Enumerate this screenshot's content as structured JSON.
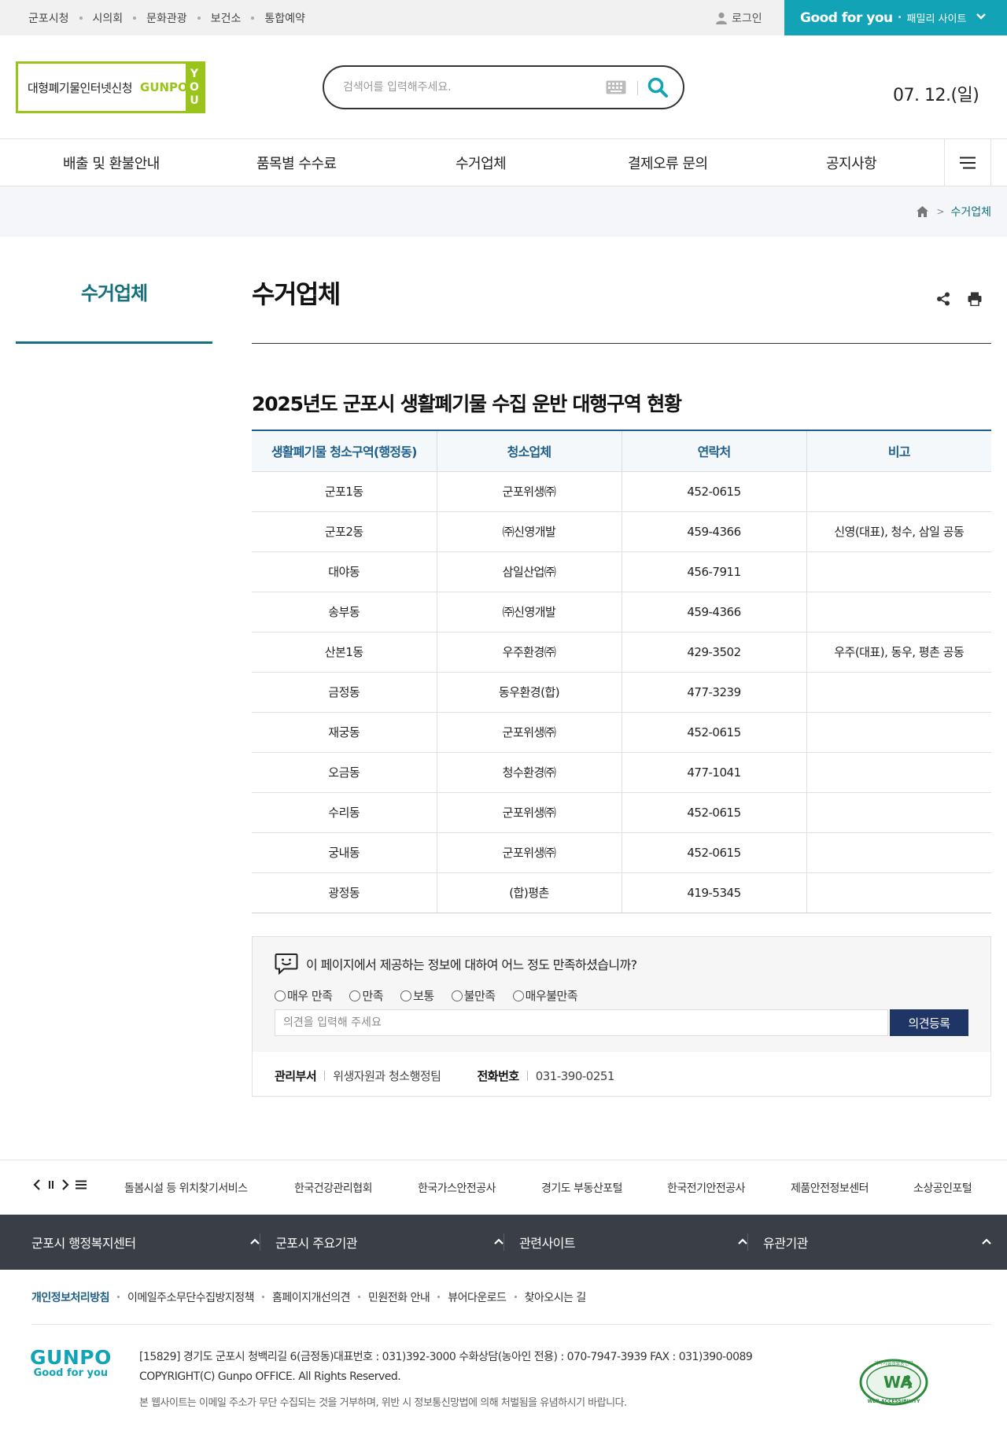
{
  "topbar": {
    "sites": [
      "군포시청",
      "시의회",
      "문화관광",
      "보건소",
      "통합예약"
    ],
    "login": "로그인",
    "family_brand": "Good for you",
    "family_label": "패밀리 사이트"
  },
  "header": {
    "logo_text": "대형폐기물인터넷신청",
    "logo_gunpo": "GUNPO",
    "logo_you": [
      "Y",
      "O",
      "U"
    ],
    "search_placeholder": "검색어를 입력해주세요.",
    "date": "07. 12.(일)"
  },
  "gnb": {
    "items": [
      "배출 및 환불안내",
      "품목별 수수료",
      "수거업체",
      "결제오류 문의",
      "공지사항"
    ]
  },
  "breadcrumb": {
    "current": "수거업체"
  },
  "lnb": {
    "title": "수거업체"
  },
  "page": {
    "title": "수거업체",
    "section_title": "2025년도 군포시 생활폐기물 수집 운반 대행구역 현황"
  },
  "table": {
    "headers": [
      "생활폐기물 청소구역(행정동)",
      "청소업체",
      "연락처",
      "비고"
    ],
    "rows": [
      [
        "군포1동",
        "군포위생㈜",
        "452-0615",
        ""
      ],
      [
        "군포2동",
        "㈜신영개발",
        "459-4366",
        "신영(대표), 청수, 삼일 공동"
      ],
      [
        "대야동",
        "삼일산업㈜",
        "456-7911",
        ""
      ],
      [
        "송부동",
        "㈜신영개발",
        "459-4366",
        ""
      ],
      [
        "산본1동",
        "우주환경㈜",
        "429-3502",
        "우주(대표), 동우, 평촌 공동"
      ],
      [
        "금정동",
        "동우환경(합)",
        "477-3239",
        ""
      ],
      [
        "재궁동",
        "군포위생㈜",
        "452-0615",
        ""
      ],
      [
        "오금동",
        "청수환경㈜",
        "477-1041",
        ""
      ],
      [
        "수리동",
        "군포위생㈜",
        "452-0615",
        ""
      ],
      [
        "궁내동",
        "군포위생㈜",
        "452-0615",
        ""
      ],
      [
        "광정동",
        "(합)평촌",
        "419-5345",
        ""
      ]
    ]
  },
  "survey": {
    "question": "이 페이지에서 제공하는 정보에 대하여 어느 정도 만족하셨습니까?",
    "options": [
      "매우 만족",
      "만족",
      "보통",
      "불만족",
      "매우불만족"
    ],
    "opinion_placeholder": "의견을 입력해 주세요",
    "submit": "의견등록",
    "manager_label": "관리부서",
    "manager_value": "위생자원과 청소행정팀",
    "phone_label": "전화번호",
    "phone_value": "031-390-0251"
  },
  "banner": {
    "sites": [
      "돌봄시설 등 위치찾기서비스",
      "한국건강관리협회",
      "한국가스안전공사",
      "경기도 부동산포털",
      "한국전기안전공사",
      "제품안전정보센터",
      "소상공인포털"
    ]
  },
  "footer_bar": [
    "군포시 행정복지센터",
    "군포시 주요기관",
    "관련사이트",
    "유관기관"
  ],
  "footer_links": [
    "개인정보처리방침",
    "이메일주소무단수집방지정책",
    "홈페이지개선의견",
    "민원전화 안내",
    "뷰어다운로드",
    "찾아오시는 길"
  ],
  "footer": {
    "logo": "GUNPO",
    "logo_sub": "Good for you",
    "address": "[15829] 경기도 군포시 청백리길 6(금정동)대표번호 : 031)392-3000 수화상담(농아인 전용) : 070-7947-3939 FAX : 031)390-0089",
    "copyright": "COPYRIGHT(C) Gunpo OFFICE. All Rights Reserved.",
    "warning": "본 웹사이트는 이메일 주소가 무단 수집되는 것을 거부하며, 위반 시 정보통신망법에 의해 처벌됨을 유념하시기 바랍니다.",
    "wa_label": "WA",
    "wa_top": "과학기술정보통신부",
    "wa_bottom": "WEB ACCESSIBILITY"
  },
  "colors": {
    "teal": "#12a4b6",
    "lime": "#9bc41b",
    "navy": "#1f3566",
    "dark_teal": "#15707e"
  }
}
